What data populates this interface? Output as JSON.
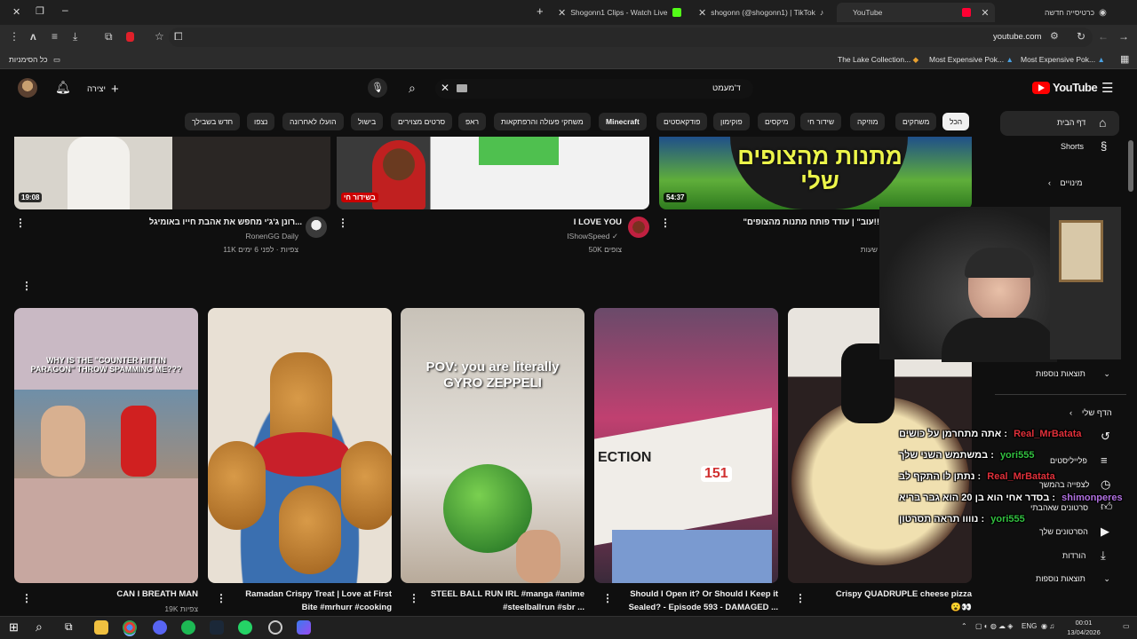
{
  "browser": {
    "tabs": [
      {
        "title": "כרטיסייה חדשה"
      },
      {
        "title": "YouTube"
      },
      {
        "title": "shogonn (@shogonn1) | TikTok"
      },
      {
        "title": "Shogonn1 Clips - Watch Live"
      }
    ],
    "address": "youtube.com",
    "bookmarks": {
      "all_bookmarks": "כל הסימניות",
      "items": [
        "The Lake Collection...",
        "Most Expensive Pok...",
        "Most Expensive Pok..."
      ]
    }
  },
  "youtube": {
    "logo_text": "YouTube",
    "search_value": "ד'מעמט",
    "create_label": "יצירה",
    "chips": [
      "הכל",
      "משחקים",
      "מוזיקה",
      "שידור חי",
      "מיקסים",
      "פוקימון",
      "פודקאסטים",
      "Minecraft",
      "משחקי פעולה והרפתקאות",
      "ראפ",
      "סרטים מצוירים",
      "בישול",
      "הועלו לאחרונה",
      "נצפו",
      "חדש בשבילך"
    ],
    "sidebar": {
      "home": "דף הבית",
      "shorts": "Shorts",
      "subscriptions": "מינויים",
      "more_results": "תוצאות נוספות",
      "you": "הדף שלי",
      "history": "היסטוריה",
      "playlists": "פלייליסטים",
      "watch_later": "לצפייה בהמשך",
      "liked": "סרטונים שאהבתי",
      "your_videos": "הסרטונים שלך",
      "downloads": "הורדות",
      "more_results2": "תוצאות נוספות"
    },
    "top_videos": [
      {
        "duration": "54:37",
        "title": "\"עוב\" | עודד פותח מתנות מהצופים!!",
        "meta": "שעות"
      },
      {
        "live_badge": "בשידור חי",
        "title": "I LOVE YOU",
        "channel": "IShowSpeed",
        "meta": "50K צופים"
      },
      {
        "duration": "19:08",
        "title": "רונן ג'ג'י מחפש את אהבת חייו באומיגל...",
        "channel": "RonenGG Daily",
        "meta": "11K צפיות · לפני 6 ימים"
      }
    ],
    "top_thumb_text": "מתנות מהצופים שלי",
    "shorts": [
      {
        "title": "Crispy QUADRUPLE cheese pizza",
        "title2": "😮👀",
        "meta": ""
      },
      {
        "title": "Should I Open it? Or Should I Keep it",
        "title2": "Sealed? - Episode 593 - DAMAGED ...",
        "meta": ""
      },
      {
        "title": "STEEL BALL RUN IRL #manga #anime",
        "title2": "#steelballrun #sbr ...",
        "meta": "",
        "overlay": "POV: you are literally GYRO ZEPPELI"
      },
      {
        "title": "Ramadan Crispy Treat | Love at First",
        "title2": "Bite #mrhurr #cooking",
        "meta": ""
      },
      {
        "title": "CAN I BREATH MAN",
        "title2": "",
        "meta": "19K צפיות",
        "overlay": "WHY IS THE \"COUNTER HITTIN PARAGON\" THROW SPAMMING ME???"
      }
    ],
    "pizza_box_text": "ECTION",
    "pizza_box_badge": "151"
  },
  "chat": [
    {
      "user": "Real_MrBatata",
      "msg": "אתה מתחרמן על כושים :",
      "color": "#e0303a"
    },
    {
      "user": "yori555",
      "msg": "במשתמש השני שלך :",
      "color": "#32c040"
    },
    {
      "user": "Real_MrBatata",
      "msg": "נתתן לו התקף לב :",
      "color": "#e0303a"
    },
    {
      "user": "shimonperes",
      "msg": "בסדר אחי הוא בן 20 הוא גבר בריא :",
      "color": "#b070e0"
    },
    {
      "user": "yori555",
      "msg": "נוווו תראה תסרטון :",
      "color": "#32c040"
    }
  ],
  "taskbar": {
    "lang": "ENG",
    "time": "00:01",
    "date": "13/04/2026"
  },
  "colors": {
    "yt_red": "#ff0000",
    "bg": "#0f0f0f",
    "chip": "#272727"
  }
}
